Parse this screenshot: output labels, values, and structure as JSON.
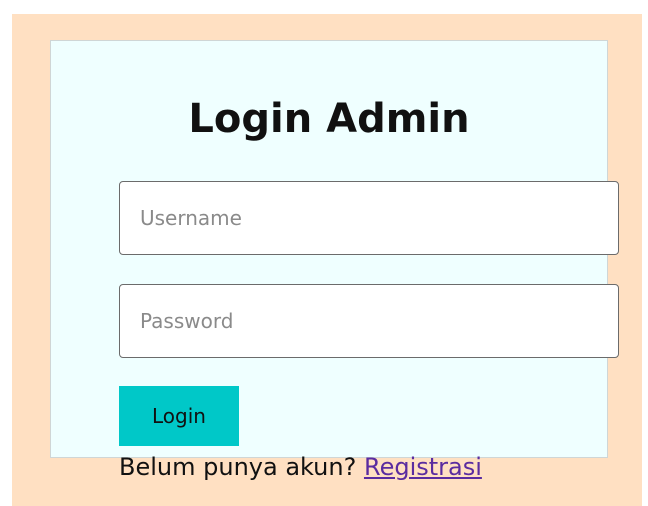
{
  "login": {
    "title": "Login Admin",
    "username_placeholder": "Username",
    "password_placeholder": "Password",
    "submit_label": "Login",
    "no_account_text": "Belum punya akun?",
    "register_link_label": "Registrasi"
  },
  "colors": {
    "page_background": "#ffe0c2",
    "card_background": "#efffff",
    "button_background": "#00c8c8",
    "link_color": "#5a2ca0"
  }
}
